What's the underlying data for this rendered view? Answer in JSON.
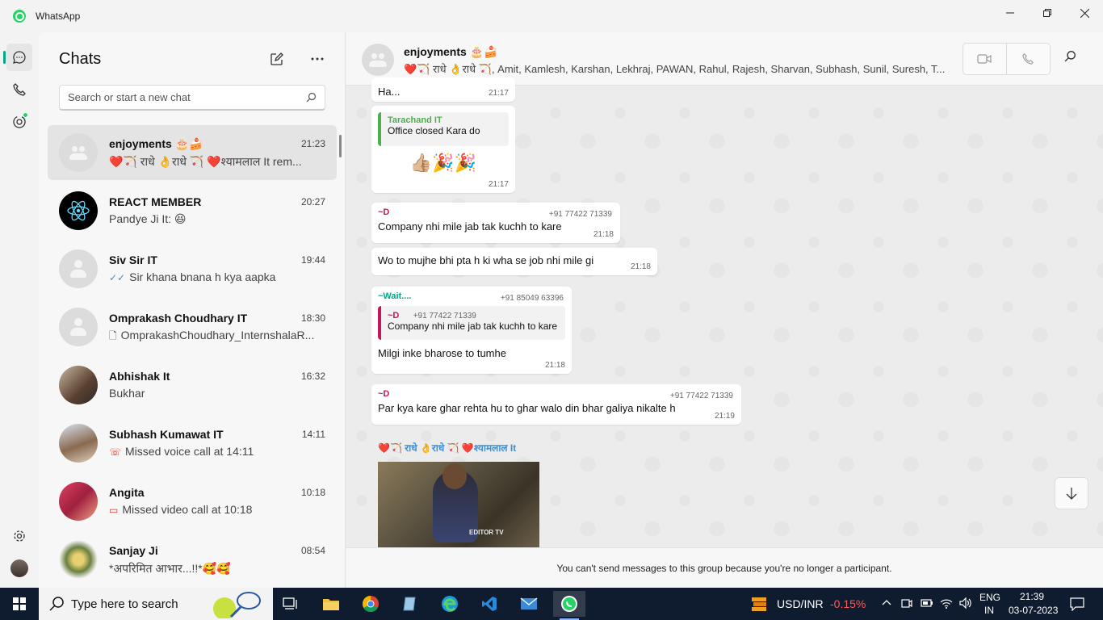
{
  "window": {
    "title": "WhatsApp"
  },
  "sidebar": {
    "title": "Chats",
    "search_placeholder": "Search or start a new chat"
  },
  "chats": [
    {
      "name": "enjoyments 🎂🍰",
      "time": "21:23",
      "preview": "❤️🏹 राधे 👌राधे 🏹    ❤️श्यामलाल It rem...",
      "preview_icon": "",
      "avatar": "group"
    },
    {
      "name": "REACT MEMBER",
      "time": "20:27",
      "preview": "Pandye Ji It: 😆",
      "preview_icon": "",
      "avatar": "react"
    },
    {
      "name": "Siv Sir IT",
      "time": "19:44",
      "preview": "Sir khana bnana h kya aapka",
      "preview_icon": "✓✓",
      "avatar": "person"
    },
    {
      "name": "Omprakash Choudhary IT",
      "time": "18:30",
      "preview": "OmprakashChoudhary_InternshalaR...",
      "preview_icon": "🗋",
      "avatar": "person"
    },
    {
      "name": "Abhishak It",
      "time": "16:32",
      "preview": "Bukhar",
      "preview_icon": "",
      "avatar": "photo1"
    },
    {
      "name": "Subhash Kumawat IT",
      "time": "14:11",
      "preview": "Missed voice call at 14:11",
      "preview_icon": "☏",
      "avatar": "photo2"
    },
    {
      "name": "Angita",
      "time": "10:18",
      "preview": "Missed video call at 10:18",
      "preview_icon": "▭",
      "avatar": "photo3"
    },
    {
      "name": "Sanjay Ji",
      "time": "08:54",
      "preview": "*अपरिमित आभार...!!*🥰🥰",
      "preview_icon": "",
      "avatar": "photo4"
    }
  ],
  "conversation": {
    "name": "enjoyments 🎂🍰",
    "members": "❤️🏹 राधे 👌राधे 🏹, Amit, Kamlesh, Karshan, Lekhraj, PAWAN, Rahul, Rajesh, Sharvan, Subhash, Sunil, Suresh, T...",
    "footer": "You can't send messages to this group because you're no longer a participant.",
    "messages": {
      "m0": {
        "text": "Ha...",
        "time": "21:17"
      },
      "m1": {
        "quote_sender": "Tarachand IT",
        "quote_text": "Office closed Kara do",
        "text": "👍🏼🎉🎉",
        "time": "21:17"
      },
      "m2": {
        "sender": "~D",
        "phone": "+91 77422 71339",
        "text": "Company nhi mile jab tak kuchh to kare",
        "time": "21:18"
      },
      "m3": {
        "text": "Wo to mujhe bhi pta h ki wha se job nhi mile gi",
        "time": "21:18"
      },
      "m4": {
        "sender": "~Wait....",
        "phone": "+91 85049 63396",
        "quote_sender": "~D",
        "quote_phone": "+91 77422 71339",
        "quote_text": "Company nhi mile jab tak kuchh to kare",
        "text": "Milgi inke bharose to tumhe",
        "time": "21:18"
      },
      "m5": {
        "sender": "~D",
        "phone": "+91 77422 71339",
        "text": "Par kya kare ghar rehta hu to ghar walo din bhar galiya nikalte h",
        "time": "21:19"
      },
      "m6": {
        "sender": "❤️🏹 राधे 👌राधे 🏹 ❤️श्यामलाल It",
        "video_watermark": "EDITOR TV"
      }
    }
  },
  "taskbar": {
    "search_placeholder": "Type here to search",
    "currency": "USD/INR",
    "change": "-0.15%",
    "lang1": "ENG",
    "lang2": "IN",
    "time": "21:39",
    "date": "03-07-2023"
  },
  "colors": {
    "accent": "#00a884",
    "sender_pink": "#c2185b",
    "sender_teal": "#00a884",
    "quote_green": "#4caf50",
    "missed": "#d03535",
    "change_red": "#ff5a5a"
  }
}
